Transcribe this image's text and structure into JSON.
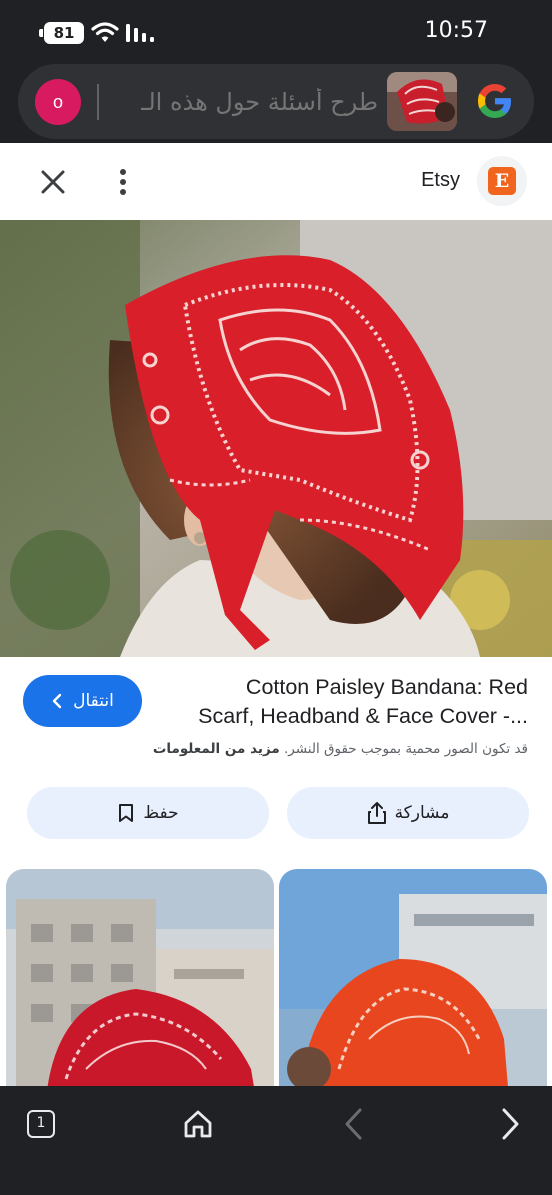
{
  "status_bar": {
    "battery": "81",
    "time": "10:57"
  },
  "search": {
    "avatar_letter": "o",
    "placeholder": "طرح أسئلة حول هذه الـ",
    "image_thumbnail_icon": "image-thumbnail",
    "lens_icon": "google-logo-icon"
  },
  "source_bar": {
    "source_name": "Etsy",
    "source_logo_letter": "E"
  },
  "result": {
    "title": "Cotton Paisley Bandana: Red Scarf, Headband & Face Cover -...",
    "visit_label": "انتقال",
    "copyright_text": "قد تكون الصور محمية بموجب حقوق النشر.",
    "more_info_label": "مزيد من المعلومات",
    "share_label": "مشاركة",
    "save_label": "حفظ"
  },
  "colors": {
    "dark_bg": "#202124",
    "accent_blue": "#1a73e8",
    "button_tint": "#e8f0fe",
    "bandana_red": "#d81f2a",
    "etsy_orange": "#f1641e"
  },
  "bottom_nav": {
    "tab_count": "1",
    "home_icon": "home-icon",
    "back_icon": "back-arrow-icon",
    "forward_icon": "forward-arrow-icon"
  }
}
